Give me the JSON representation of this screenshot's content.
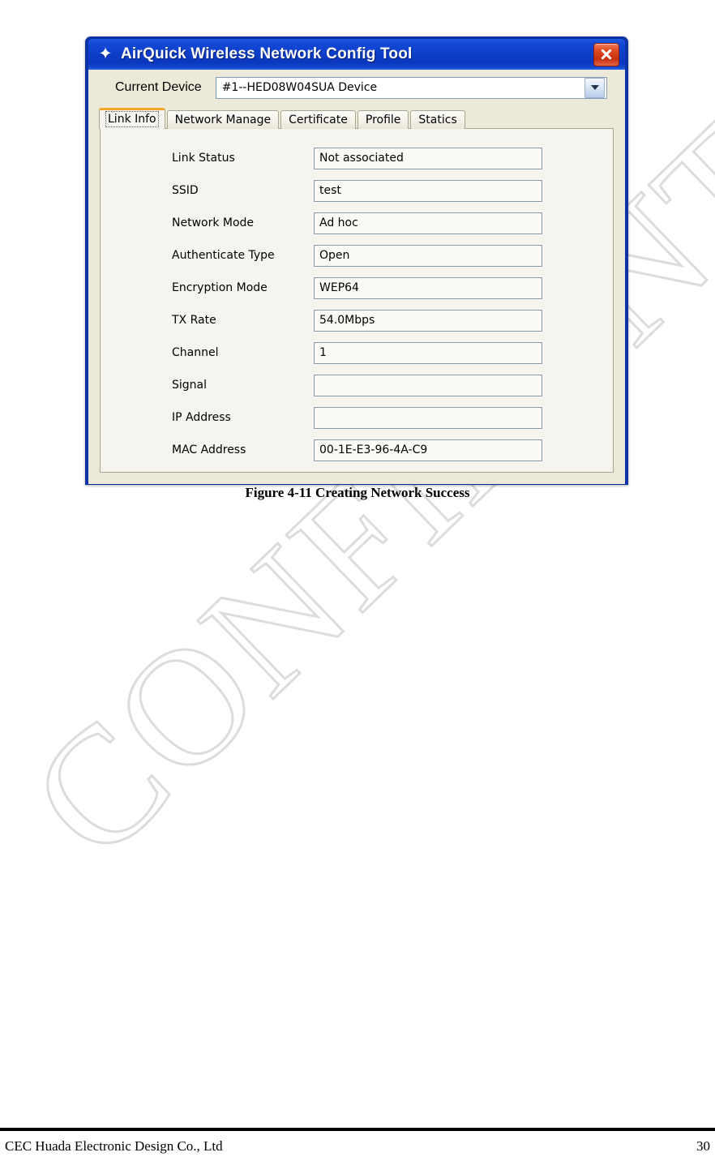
{
  "page": {
    "watermark": "CONFIDENTIAL",
    "caption": "Figure 4-11 Creating Network Success",
    "footer_left": "CEC Huada Electronic Design Co., Ltd",
    "footer_page": "30"
  },
  "window": {
    "title": "AirQuick Wireless Network Config Tool",
    "star_icon": "star-icon",
    "close_icon": "close-icon",
    "titlebar_color": "#0d3ec9",
    "close_color": "#c5300d"
  },
  "device": {
    "label": "Current Device",
    "value": "#1--HED08W04SUA Device",
    "dropdown_icon": "chevron-down-icon"
  },
  "tabs": [
    {
      "label": "Link Info",
      "selected": true
    },
    {
      "label": "Network Manage",
      "selected": false
    },
    {
      "label": "Certificate",
      "selected": false
    },
    {
      "label": "Profile",
      "selected": false
    },
    {
      "label": "Statics",
      "selected": false
    }
  ],
  "link_info": {
    "fields": [
      {
        "label": "Link Status",
        "value": "Not associated"
      },
      {
        "label": "SSID",
        "value": "test"
      },
      {
        "label": "Network Mode",
        "value": "Ad hoc"
      },
      {
        "label": "Authenticate Type",
        "value": "Open"
      },
      {
        "label": "Encryption Mode",
        "value": "WEP64"
      },
      {
        "label": "TX Rate",
        "value": "54.0Mbps"
      },
      {
        "label": "Channel",
        "value": "1"
      },
      {
        "label": "Signal",
        "value": ""
      },
      {
        "label": "IP Address",
        "value": ""
      },
      {
        "label": "MAC Address",
        "value": "00-1E-E3-96-4A-C9"
      }
    ]
  }
}
